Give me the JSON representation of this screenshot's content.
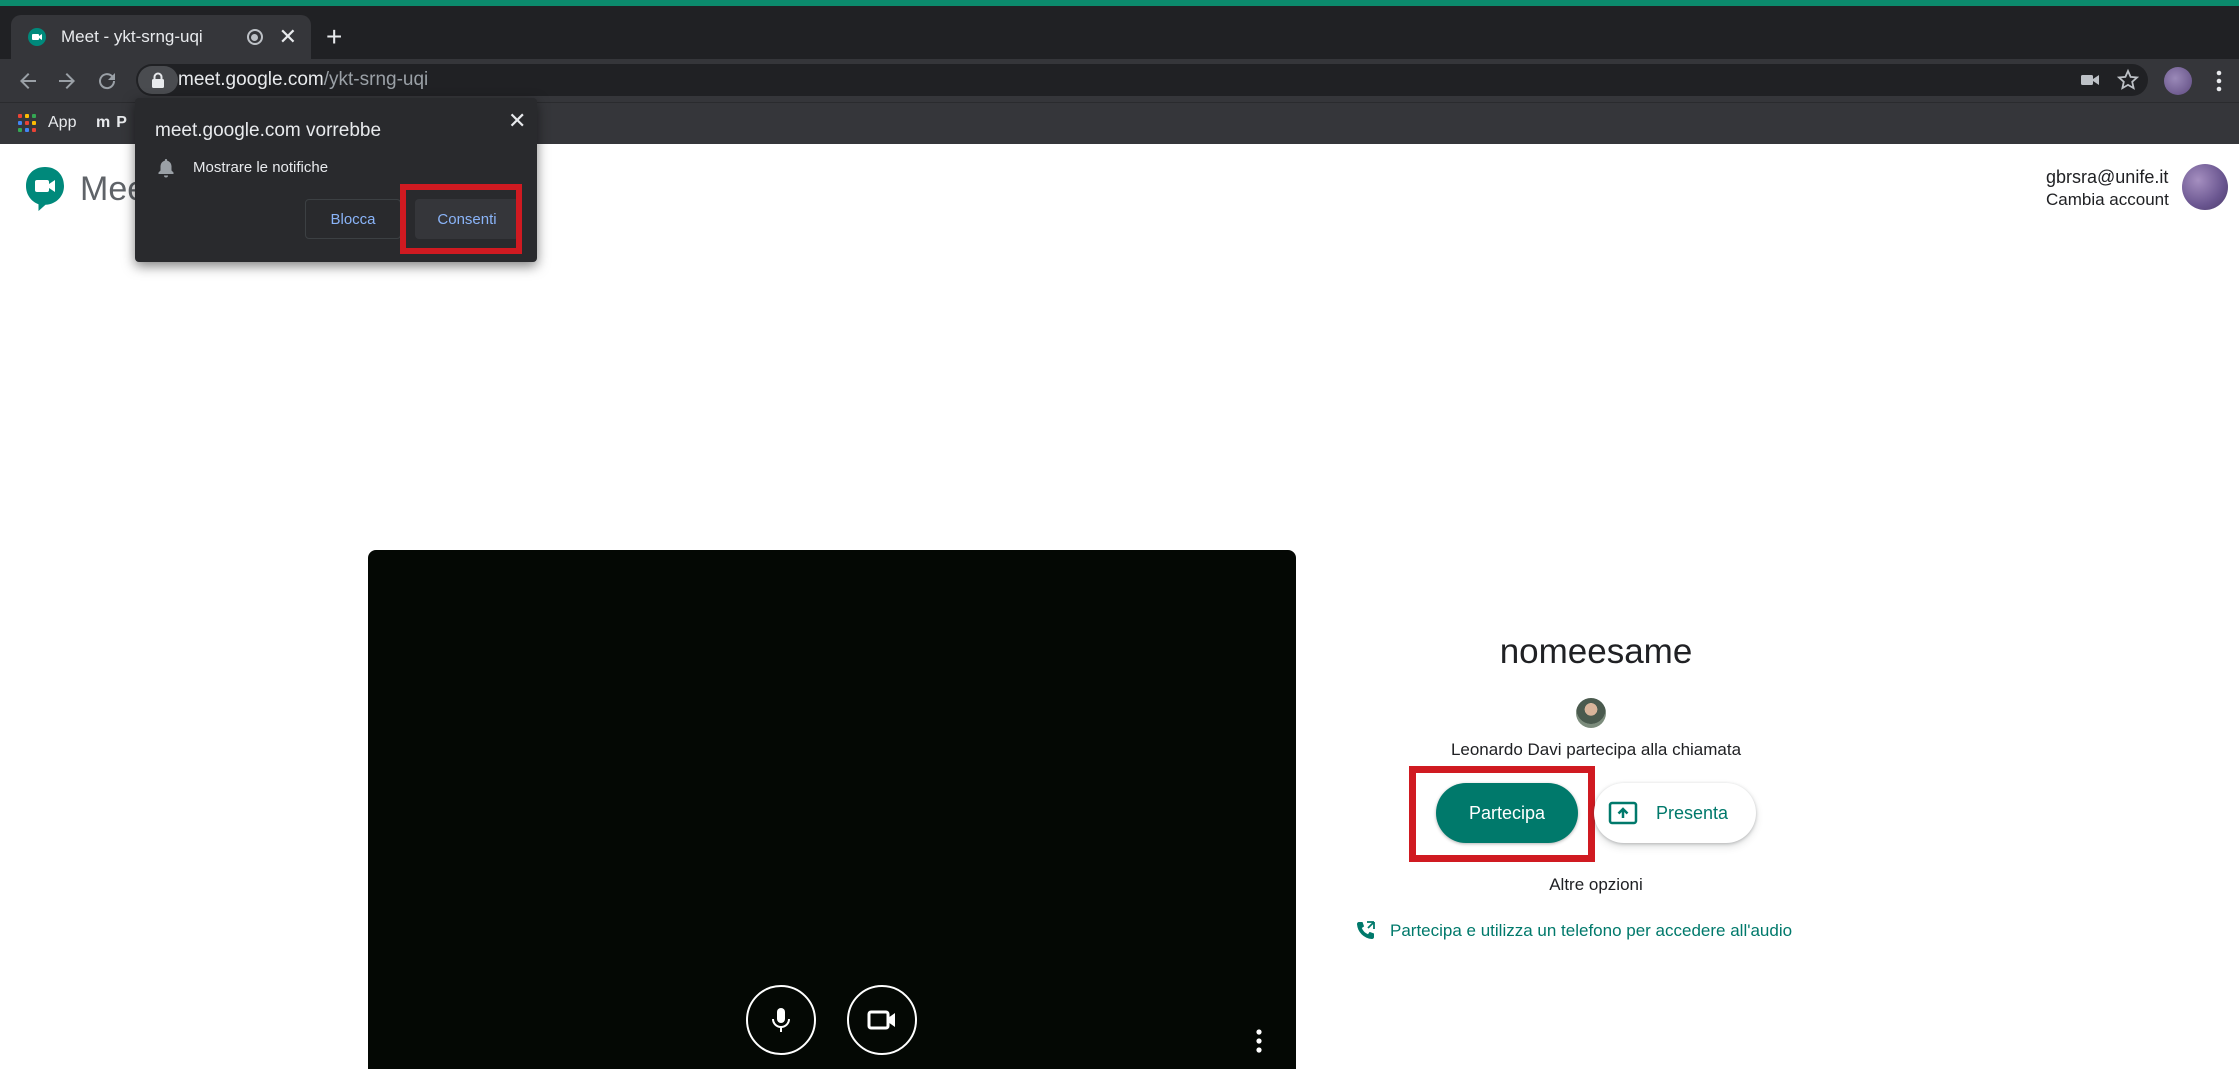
{
  "browser": {
    "tab": {
      "title": "Meet - ykt-srng-uqi"
    },
    "address": {
      "host": "meet.google.com",
      "path": "/ykt-srng-uqi"
    },
    "bookmarks": [
      {
        "label": "App"
      },
      {
        "label": "P"
      }
    ]
  },
  "notification_popup": {
    "title": "meet.google.com vorrebbe",
    "permission_text": "Mostrare le notifiche",
    "block_label": "Blocca",
    "allow_label": "Consenti"
  },
  "meet": {
    "brand": "Meet",
    "account": {
      "email": "gbrsra@unife.it",
      "switch_label": "Cambia account"
    },
    "meeting_name": "nomeesame",
    "participant_status": "Leonardo Davi partecipa alla chiamata",
    "join_label": "Partecipa",
    "present_label": "Presenta",
    "other_options_label": "Altre opzioni",
    "phone_join_label": "Partecipa e utilizza un telefono per accedere all'audio"
  },
  "colors": {
    "accent_bar": "#0b8a6c",
    "meet_green": "#00796b",
    "highlight_red": "#d01a21",
    "chrome_dark": "#202124"
  }
}
